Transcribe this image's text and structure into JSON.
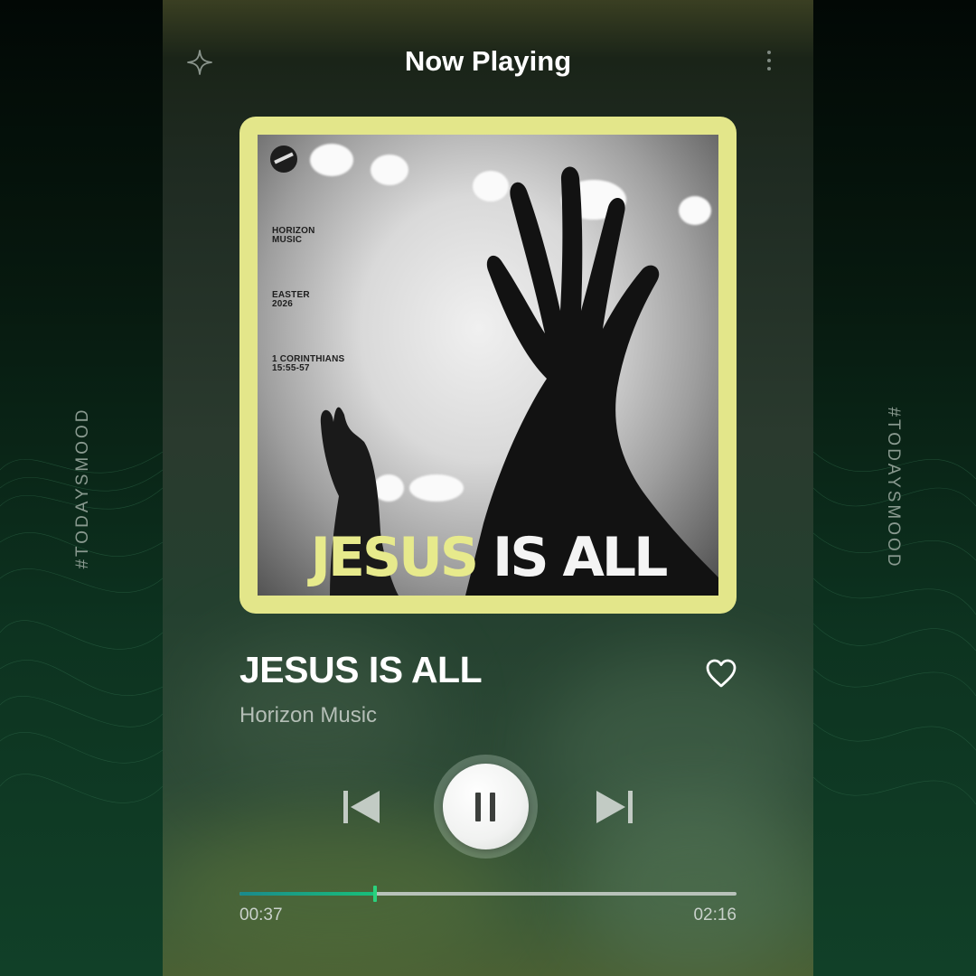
{
  "side_tag": "#TODAYSMOOD",
  "header": {
    "title": "Now Playing",
    "left_icon": "sparkle-icon",
    "right_icon": "more-vertical-icon"
  },
  "album_art": {
    "label_line1": "HORIZON\nMUSIC",
    "label_line2": "EASTER\n2026",
    "label_line3": "1 CORINTHIANS\n15:55-57",
    "headline_word1": "JESUS",
    "headline_word2": "IS ALL",
    "accent_color": "#e3e68a"
  },
  "track": {
    "title": "JESUS IS ALL",
    "artist": "Horizon Music",
    "favorite_icon": "heart-outline-icon"
  },
  "controls": {
    "previous_icon": "skip-previous-icon",
    "play_pause_icon": "pause-icon",
    "next_icon": "skip-next-icon"
  },
  "progress": {
    "elapsed": "00:37",
    "total": "02:16",
    "fraction": 0.272,
    "fill_color": "#19c07a"
  }
}
